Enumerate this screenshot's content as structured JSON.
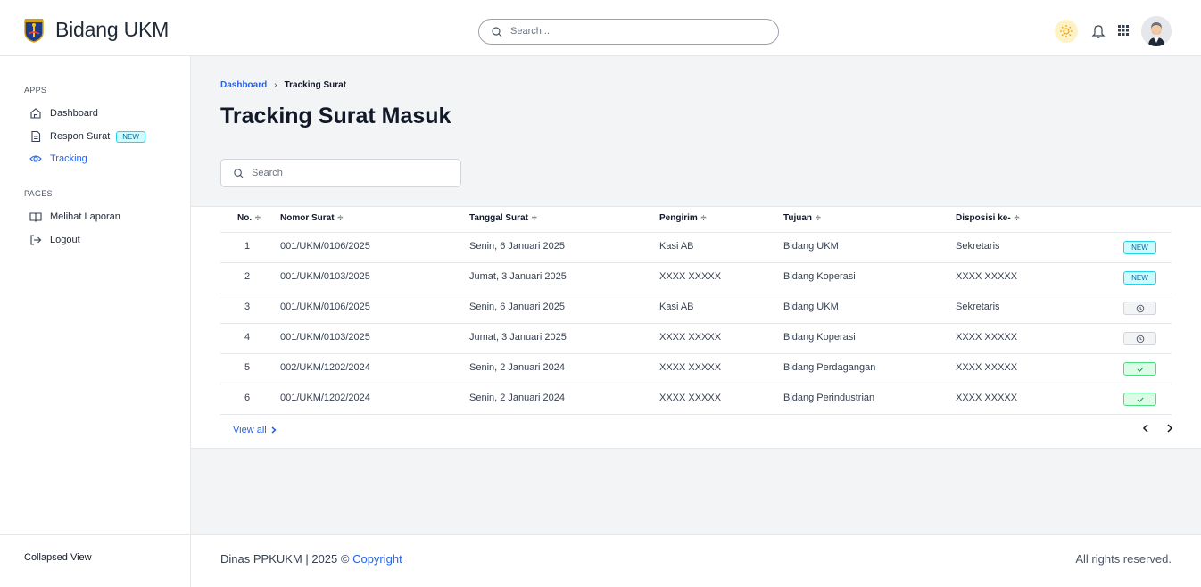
{
  "header": {
    "brand": "Bidang UKM",
    "search_placeholder": "Search..."
  },
  "sidebar": {
    "apps_title": "APPS",
    "apps": [
      {
        "label": "Dashboard",
        "icon": "home-icon"
      },
      {
        "label": "Respon Surat",
        "icon": "document-icon",
        "badge": "NEW"
      },
      {
        "label": "Tracking",
        "icon": "eye-icon",
        "active": true
      }
    ],
    "pages_title": "PAGES",
    "pages": [
      {
        "label": "Melihat Laporan",
        "icon": "book-open-icon"
      },
      {
        "label": "Logout",
        "icon": "logout-icon"
      }
    ],
    "collapsed_label": "Collapsed View"
  },
  "breadcrumb": {
    "link": "Dashboard",
    "separator": "›",
    "current": "Tracking Surat"
  },
  "page_title": "Tracking Surat Masuk",
  "search": {
    "placeholder": "Search"
  },
  "table": {
    "sort_glyph": "≑",
    "headers": [
      "No.",
      "Nomor Surat",
      "Tanggal Surat",
      "Pengirim",
      "Tujuan",
      "Disposisi ke-"
    ],
    "rows": [
      {
        "no": "1",
        "nomor": "001/UKM/0106/2025",
        "tanggal": "Senin, 6 Januari 2025",
        "pengirim": "Kasi AB",
        "tujuan": "Bidang UKM",
        "disposisi": "Sekretaris",
        "status": "new",
        "status_label": "NEW"
      },
      {
        "no": "2",
        "nomor": "001/UKM/0103/2025",
        "tanggal": "Jumat, 3 Januari 2025",
        "pengirim": "XXXX XXXXX",
        "tujuan": "Bidang Koperasi",
        "disposisi": "XXXX XXXXX",
        "status": "new",
        "status_label": "NEW"
      },
      {
        "no": "3",
        "nomor": "001/UKM/0106/2025",
        "tanggal": "Senin, 6 Januari 2025",
        "pengirim": "Kasi AB",
        "tujuan": "Bidang UKM",
        "disposisi": "Sekretaris",
        "status": "pending",
        "status_label": ""
      },
      {
        "no": "4",
        "nomor": "001/UKM/0103/2025",
        "tanggal": "Jumat, 3 Januari 2025",
        "pengirim": "XXXX XXXXX",
        "tujuan": "Bidang Koperasi",
        "disposisi": "XXXX XXXXX",
        "status": "pending",
        "status_label": ""
      },
      {
        "no": "5",
        "nomor": "002/UKM/1202/2024",
        "tanggal": "Senin, 2 Januari 2024",
        "pengirim": "XXXX XXXXX",
        "tujuan": "Bidang Perdagangan",
        "disposisi": "XXXX XXXXX",
        "status": "done",
        "status_label": ""
      },
      {
        "no": "6",
        "nomor": "001/UKM/1202/2024",
        "tanggal": "Senin, 2 Januari 2024",
        "pengirim": "XXXX XXXXX",
        "tujuan": "Bidang Perindustrian",
        "disposisi": "XXXX XXXXX",
        "status": "done",
        "status_label": ""
      }
    ],
    "view_all": "View all"
  },
  "footer": {
    "left_text": "Dinas PPKUKM | 2025 © ",
    "copyright_link": "Copyright",
    "right_text": "All rights reserved."
  },
  "colors": {
    "accent": "#2563eb",
    "badge_new_bg": "#cffafe",
    "status_done_bg": "#dcfce7"
  }
}
